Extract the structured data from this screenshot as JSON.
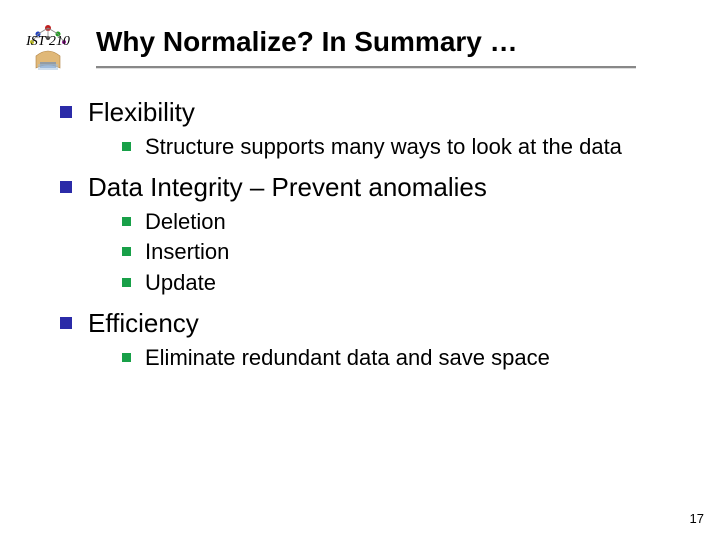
{
  "course_label": "IST 210",
  "title": "Why Normalize?  In Summary …",
  "bullets": [
    {
      "text": "Flexibility",
      "children": [
        "Structure supports many ways to look at the data"
      ]
    },
    {
      "text": "Data Integrity – Prevent anomalies",
      "children": [
        "Deletion",
        "Insertion",
        "Update"
      ]
    },
    {
      "text": "Efficiency",
      "children": [
        "Eliminate redundant data and save space"
      ]
    }
  ],
  "page_number": "17"
}
